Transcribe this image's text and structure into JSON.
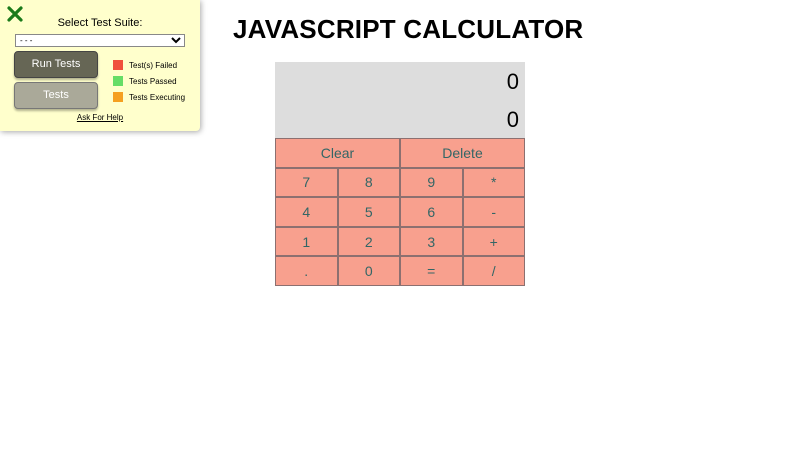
{
  "test_panel": {
    "select_label": "Select Test Suite:",
    "select_value": "- - -",
    "run_button": "Run Tests",
    "tests_button": "Tests",
    "legend": [
      {
        "label": "Test(s) Failed",
        "color": "#f0503c"
      },
      {
        "label": "Tests Passed",
        "color": "#66dd66"
      },
      {
        "label": "Tests Executing",
        "color": "#f5a020"
      }
    ],
    "help_link": "Ask For Help",
    "close_icon_color": "#1a7a1a"
  },
  "page": {
    "title": "JAVASCRIPT CALCULATOR"
  },
  "calculator": {
    "formula": "0",
    "output": "0",
    "buttons": {
      "clear": "Clear",
      "delete": "Delete",
      "seven": "7",
      "eight": "8",
      "nine": "9",
      "multiply": "*",
      "four": "4",
      "five": "5",
      "six": "6",
      "subtract": "-",
      "one": "1",
      "two": "2",
      "three": "3",
      "add": "+",
      "decimal": ".",
      "zero": "0",
      "equals": "=",
      "divide": "/"
    },
    "colors": {
      "display_bg": "#dddddd",
      "button_bg": "#f8a08e",
      "button_text": "#336666"
    }
  }
}
